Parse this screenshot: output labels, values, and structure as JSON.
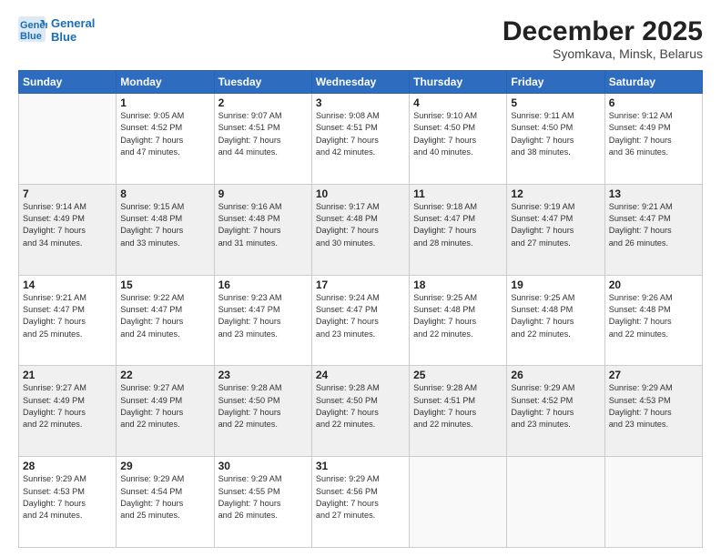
{
  "header": {
    "logo_line1": "General",
    "logo_line2": "Blue",
    "month": "December 2025",
    "location": "Syomkava, Minsk, Belarus"
  },
  "weekdays": [
    "Sunday",
    "Monday",
    "Tuesday",
    "Wednesday",
    "Thursday",
    "Friday",
    "Saturday"
  ],
  "weeks": [
    [
      {
        "day": "",
        "info": ""
      },
      {
        "day": "1",
        "info": "Sunrise: 9:05 AM\nSunset: 4:52 PM\nDaylight: 7 hours\nand 47 minutes."
      },
      {
        "day": "2",
        "info": "Sunrise: 9:07 AM\nSunset: 4:51 PM\nDaylight: 7 hours\nand 44 minutes."
      },
      {
        "day": "3",
        "info": "Sunrise: 9:08 AM\nSunset: 4:51 PM\nDaylight: 7 hours\nand 42 minutes."
      },
      {
        "day": "4",
        "info": "Sunrise: 9:10 AM\nSunset: 4:50 PM\nDaylight: 7 hours\nand 40 minutes."
      },
      {
        "day": "5",
        "info": "Sunrise: 9:11 AM\nSunset: 4:50 PM\nDaylight: 7 hours\nand 38 minutes."
      },
      {
        "day": "6",
        "info": "Sunrise: 9:12 AM\nSunset: 4:49 PM\nDaylight: 7 hours\nand 36 minutes."
      }
    ],
    [
      {
        "day": "7",
        "info": "Sunrise: 9:14 AM\nSunset: 4:49 PM\nDaylight: 7 hours\nand 34 minutes."
      },
      {
        "day": "8",
        "info": "Sunrise: 9:15 AM\nSunset: 4:48 PM\nDaylight: 7 hours\nand 33 minutes."
      },
      {
        "day": "9",
        "info": "Sunrise: 9:16 AM\nSunset: 4:48 PM\nDaylight: 7 hours\nand 31 minutes."
      },
      {
        "day": "10",
        "info": "Sunrise: 9:17 AM\nSunset: 4:48 PM\nDaylight: 7 hours\nand 30 minutes."
      },
      {
        "day": "11",
        "info": "Sunrise: 9:18 AM\nSunset: 4:47 PM\nDaylight: 7 hours\nand 28 minutes."
      },
      {
        "day": "12",
        "info": "Sunrise: 9:19 AM\nSunset: 4:47 PM\nDaylight: 7 hours\nand 27 minutes."
      },
      {
        "day": "13",
        "info": "Sunrise: 9:21 AM\nSunset: 4:47 PM\nDaylight: 7 hours\nand 26 minutes."
      }
    ],
    [
      {
        "day": "14",
        "info": "Sunrise: 9:21 AM\nSunset: 4:47 PM\nDaylight: 7 hours\nand 25 minutes."
      },
      {
        "day": "15",
        "info": "Sunrise: 9:22 AM\nSunset: 4:47 PM\nDaylight: 7 hours\nand 24 minutes."
      },
      {
        "day": "16",
        "info": "Sunrise: 9:23 AM\nSunset: 4:47 PM\nDaylight: 7 hours\nand 23 minutes."
      },
      {
        "day": "17",
        "info": "Sunrise: 9:24 AM\nSunset: 4:47 PM\nDaylight: 7 hours\nand 23 minutes."
      },
      {
        "day": "18",
        "info": "Sunrise: 9:25 AM\nSunset: 4:48 PM\nDaylight: 7 hours\nand 22 minutes."
      },
      {
        "day": "19",
        "info": "Sunrise: 9:25 AM\nSunset: 4:48 PM\nDaylight: 7 hours\nand 22 minutes."
      },
      {
        "day": "20",
        "info": "Sunrise: 9:26 AM\nSunset: 4:48 PM\nDaylight: 7 hours\nand 22 minutes."
      }
    ],
    [
      {
        "day": "21",
        "info": "Sunrise: 9:27 AM\nSunset: 4:49 PM\nDaylight: 7 hours\nand 22 minutes."
      },
      {
        "day": "22",
        "info": "Sunrise: 9:27 AM\nSunset: 4:49 PM\nDaylight: 7 hours\nand 22 minutes."
      },
      {
        "day": "23",
        "info": "Sunrise: 9:28 AM\nSunset: 4:50 PM\nDaylight: 7 hours\nand 22 minutes."
      },
      {
        "day": "24",
        "info": "Sunrise: 9:28 AM\nSunset: 4:50 PM\nDaylight: 7 hours\nand 22 minutes."
      },
      {
        "day": "25",
        "info": "Sunrise: 9:28 AM\nSunset: 4:51 PM\nDaylight: 7 hours\nand 22 minutes."
      },
      {
        "day": "26",
        "info": "Sunrise: 9:29 AM\nSunset: 4:52 PM\nDaylight: 7 hours\nand 23 minutes."
      },
      {
        "day": "27",
        "info": "Sunrise: 9:29 AM\nSunset: 4:53 PM\nDaylight: 7 hours\nand 23 minutes."
      }
    ],
    [
      {
        "day": "28",
        "info": "Sunrise: 9:29 AM\nSunset: 4:53 PM\nDaylight: 7 hours\nand 24 minutes."
      },
      {
        "day": "29",
        "info": "Sunrise: 9:29 AM\nSunset: 4:54 PM\nDaylight: 7 hours\nand 25 minutes."
      },
      {
        "day": "30",
        "info": "Sunrise: 9:29 AM\nSunset: 4:55 PM\nDaylight: 7 hours\nand 26 minutes."
      },
      {
        "day": "31",
        "info": "Sunrise: 9:29 AM\nSunset: 4:56 PM\nDaylight: 7 hours\nand 27 minutes."
      },
      {
        "day": "",
        "info": ""
      },
      {
        "day": "",
        "info": ""
      },
      {
        "day": "",
        "info": ""
      }
    ]
  ]
}
